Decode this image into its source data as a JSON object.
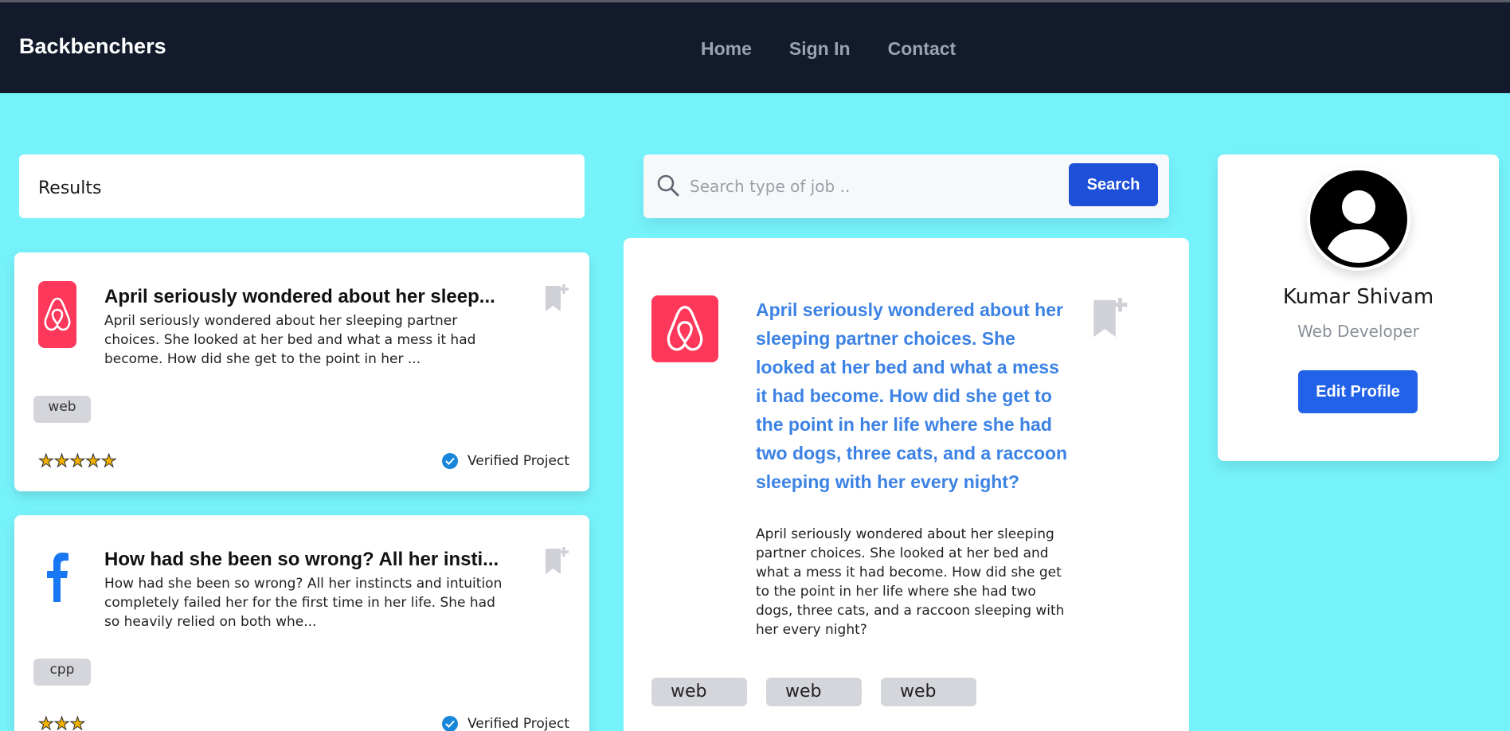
{
  "nav": {
    "brand": "Backbenchers",
    "links": [
      "Home",
      "Sign In",
      "Contact"
    ]
  },
  "results": {
    "label": "Results"
  },
  "search": {
    "placeholder": "Search type of job ..",
    "button_label": "Search"
  },
  "cards": [
    {
      "logo": "airbnb-logo",
      "title": "April seriously wondered about her sleep...",
      "description": "April seriously wondered about her sleeping partner choices. She looked at her bed and what a mess it had become. How did she get to the point in her ...",
      "tag": "web",
      "rating": 5,
      "stars": "★★★★★",
      "verified_label": "Verified Project"
    },
    {
      "logo": "facebook-logo",
      "title": "How had she been so wrong? All her insti...",
      "description": "How had she been so wrong? All her instincts and intuition completely failed her for the first time in her life. She had so heavily relied on both whe...",
      "tag": "cpp",
      "rating": 3,
      "stars": "★★★",
      "verified_label": "Verified Project"
    }
  ],
  "detail": {
    "logo": "airbnb-logo",
    "title": "April seriously wondered about her sleeping partner choices. She looked at her bed and what a mess it had become. How did she get to the point in her life where she had two dogs, three cats, and a raccoon sleeping with her every night?",
    "description": "April seriously wondered about her sleeping partner choices. She looked at her bed and what a mess it had become. How did she get to the point in her life where she had two dogs, three cats, and a raccoon sleeping with her every night?",
    "tags": [
      "web",
      "web",
      "web"
    ]
  },
  "profile": {
    "name": "Kumar Shivam",
    "role": "Web Developer",
    "edit_label": "Edit Profile"
  },
  "colors": {
    "background": "#76f2fb",
    "navbar": "#121a2b",
    "airbnb": "#fd385a",
    "facebook": "#1877f2",
    "primary_button": "#1d4fd8",
    "detail_title": "#3c82e4"
  }
}
